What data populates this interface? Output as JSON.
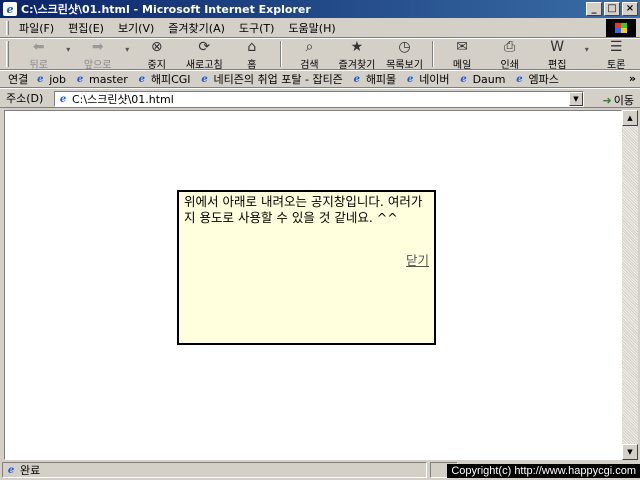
{
  "window": {
    "title": "C:\\스크린샷\\01.html - Microsoft Internet Explorer",
    "minimize": "_",
    "maximize": "□",
    "close": "×"
  },
  "menu": [
    "파일(F)",
    "편집(E)",
    "보기(V)",
    "즐겨찾기(A)",
    "도구(T)",
    "도움말(H)"
  ],
  "toolbar": {
    "back": "뒤로",
    "forward": "앞으로",
    "stop": "중지",
    "refresh": "새로고침",
    "home": "홈",
    "search": "검색",
    "favorites": "즐겨찾기",
    "history": "목록보기",
    "mail": "메일",
    "print": "인쇄",
    "edit": "편집",
    "discuss": "토론"
  },
  "links": {
    "label": "연결",
    "items": [
      "job",
      "master",
      "해피CGI",
      "네티즌의 취업 포탈 - 잡티즌",
      "해피몰",
      "네이버",
      "Daum",
      "엠파스"
    ],
    "more": "»"
  },
  "address": {
    "label": "주소(D)",
    "value": "C:\\스크린샷\\01.html",
    "go": "이동"
  },
  "popup": {
    "message": "위에서 아래로 내려오는 공지창입니다. 여러가지 용도로 사용할 수 있을 것 같네요. ^^",
    "close_link": "닫기"
  },
  "status": {
    "text": "완료",
    "overlay": "Copyright(c) http://www.happycgi.com"
  },
  "colors": {
    "titlebar_start": "#0a246a",
    "titlebar_end": "#3a6ea5",
    "popup_bg": "#ffffdd",
    "chrome": "#d4d0c8"
  }
}
